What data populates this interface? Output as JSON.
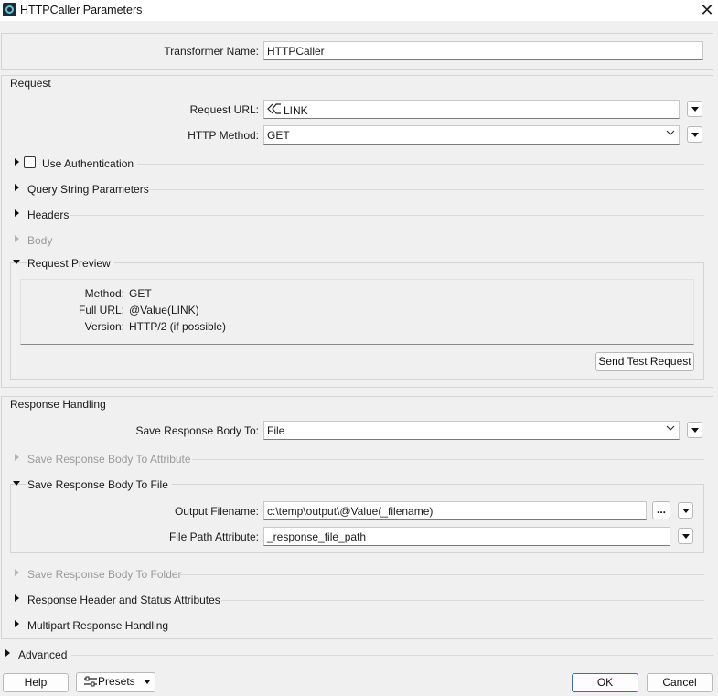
{
  "window": {
    "title": "HTTPCaller Parameters",
    "close_glyph": "✕"
  },
  "transformer": {
    "label": "Transformer Name:",
    "value": "HTTPCaller"
  },
  "request": {
    "section_title": "Request",
    "url_label": "Request URL:",
    "url_icon": "attribute-link-icon",
    "url_value": "LINK",
    "method_label": "HTTP Method:",
    "method_value": "GET",
    "use_auth": "Use Authentication",
    "query_string": "Query String Parameters",
    "headers": "Headers",
    "body": "Body",
    "preview_title": "Request Preview",
    "preview": {
      "method_label": "Method:",
      "method_value": "GET",
      "url_label": "Full URL:",
      "url_value": "@Value(LINK)",
      "version_label": "Version:",
      "version_value": "HTTP/2 (if possible)"
    },
    "send_test": "Send Test Request"
  },
  "response": {
    "section_title": "Response Handling",
    "save_to_label": "Save Response Body To:",
    "save_to_value": "File",
    "to_attribute": "Save Response Body To Attribute",
    "to_file": "Save Response Body To File",
    "output_label": "Output Filename:",
    "output_value": "c:\\temp\\output\\@Value(_filename)",
    "browse_label": "...",
    "path_attr_label": "File Path Attribute:",
    "path_attr_value": "_response_file_path",
    "to_folder": "Save Response Body To Folder",
    "header_status": "Response Header and Status Attributes",
    "multipart": "Multipart Response Handling"
  },
  "advanced": "Advanced",
  "footer": {
    "help": "Help",
    "presets": "Presets",
    "ok": "OK",
    "cancel": "Cancel"
  }
}
